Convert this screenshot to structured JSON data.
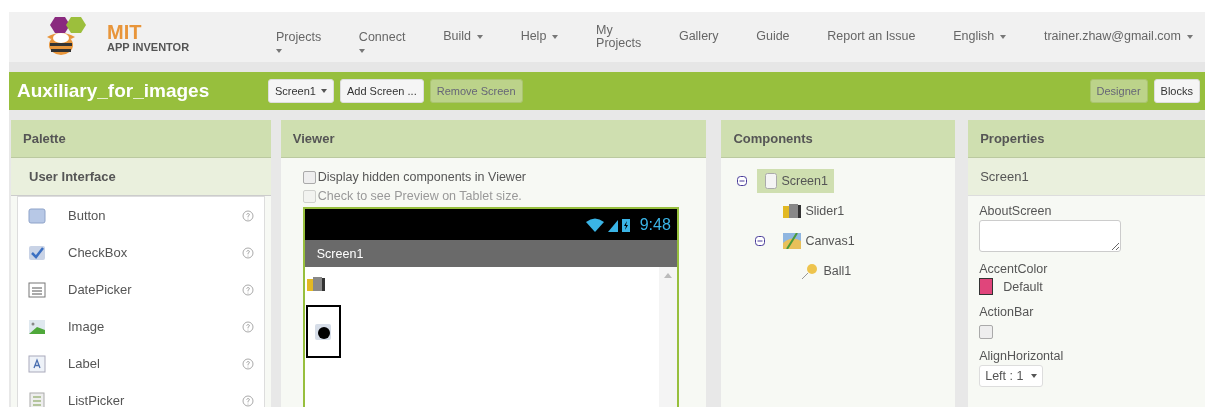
{
  "header": {
    "logo": {
      "title": "MIT",
      "subtitle": "APP INVENTOR"
    },
    "menu": [
      {
        "label": "Projects",
        "kind": "stacked"
      },
      {
        "label": "Connect",
        "kind": "stacked"
      },
      {
        "label": "Build",
        "kind": "inline"
      },
      {
        "label": "Help",
        "kind": "inline"
      },
      {
        "label": "My\nProjects",
        "kind": "plain"
      },
      {
        "label": "Gallery",
        "kind": "plain"
      },
      {
        "label": "Guide",
        "kind": "plain"
      },
      {
        "label": "Report an Issue",
        "kind": "plain"
      },
      {
        "label": "English",
        "kind": "inline"
      },
      {
        "label": "trainer.zhaw@gmail.com",
        "kind": "inline"
      }
    ]
  },
  "toolbar": {
    "project": "Auxiliary_for_images",
    "screen_select": "Screen1",
    "buttons": [
      {
        "label": "Add Screen ...",
        "disabled": false
      },
      {
        "label": "Remove Screen",
        "disabled": true
      }
    ],
    "views": [
      {
        "label": "Designer",
        "selected": true
      },
      {
        "label": "Blocks",
        "selected": false
      }
    ]
  },
  "palette": {
    "title": "Palette",
    "category": "User Interface",
    "items": [
      {
        "label": "Button",
        "kind": "button"
      },
      {
        "label": "CheckBox",
        "kind": "checkbox"
      },
      {
        "label": "DatePicker",
        "kind": "datepicker"
      },
      {
        "label": "Image",
        "kind": "image"
      },
      {
        "label": "Label",
        "kind": "label"
      },
      {
        "label": "ListPicker",
        "kind": "listpicker"
      }
    ]
  },
  "viewer": {
    "title": "Viewer",
    "options": [
      {
        "label": "Display hidden components in Viewer",
        "checked": false,
        "disabled": false
      },
      {
        "label": "Check to see Preview on Tablet size.",
        "checked": false,
        "disabled": true
      }
    ],
    "phone": {
      "time": "9:48",
      "screen_title": "Screen1"
    }
  },
  "components": {
    "title": "Components",
    "tree": [
      {
        "label": "Screen1",
        "kind": "screen",
        "selected": true,
        "expanded": true,
        "children": [
          {
            "label": "Slider1",
            "kind": "slider",
            "selected": false
          },
          {
            "label": "Canvas1",
            "kind": "canvas",
            "selected": false,
            "expanded": true,
            "children": [
              {
                "label": "Ball1",
                "kind": "ball",
                "selected": false
              }
            ]
          }
        ]
      }
    ]
  },
  "properties": {
    "title": "Properties",
    "component": "Screen1",
    "items": [
      {
        "label": "AboutScreen",
        "kind": "textarea"
      },
      {
        "label": "AccentColor",
        "kind": "color",
        "color": "#e0457b",
        "value": "Default"
      },
      {
        "label": "ActionBar",
        "kind": "checkbox",
        "checked": false
      },
      {
        "label": "AlignHorizontal",
        "kind": "dropdown",
        "value": "Left : 1"
      }
    ]
  }
}
